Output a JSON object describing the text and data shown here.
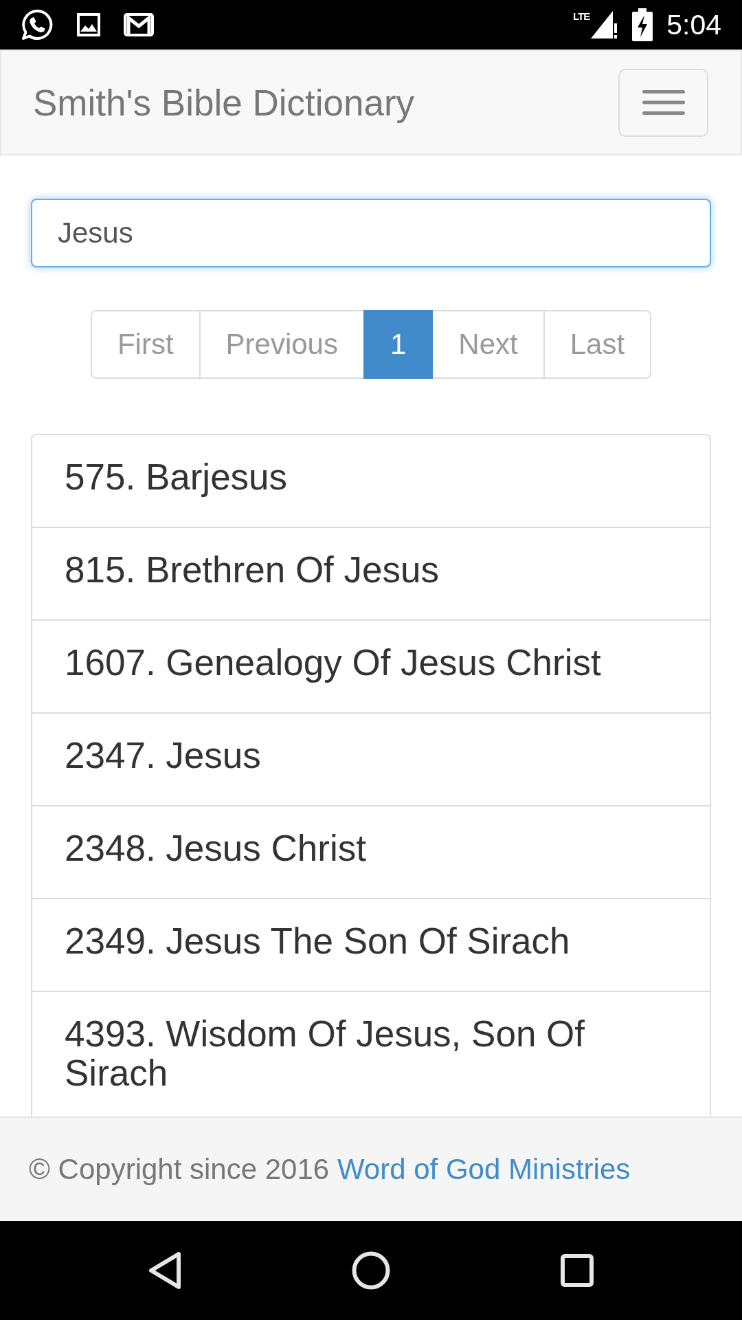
{
  "status_bar": {
    "network": "LTE",
    "time": "5:04"
  },
  "navbar": {
    "brand": "Smith's Bible Dictionary"
  },
  "search": {
    "value": "Jesus",
    "focused": true
  },
  "pagination": [
    {
      "label": "First",
      "selected": false,
      "disabled": true
    },
    {
      "label": "Previous",
      "selected": false,
      "disabled": true
    },
    {
      "label": "1",
      "selected": true,
      "disabled": false
    },
    {
      "label": "Next",
      "selected": false,
      "disabled": true
    },
    {
      "label": "Last",
      "selected": false,
      "disabled": true
    }
  ],
  "results": [
    {
      "label": "575. Barjesus"
    },
    {
      "label": "815. Brethren Of Jesus"
    },
    {
      "label": "1607. Genealogy Of Jesus Christ"
    },
    {
      "label": "2347. Jesus"
    },
    {
      "label": "2348. Jesus Christ"
    },
    {
      "label": "2349. Jesus The Son Of Sirach"
    },
    {
      "label": "4393. Wisdom Of Jesus, Son Of Sirach"
    }
  ],
  "footer": {
    "text": "© Copyright since 2016",
    "link": "Word of God Ministries"
  }
}
